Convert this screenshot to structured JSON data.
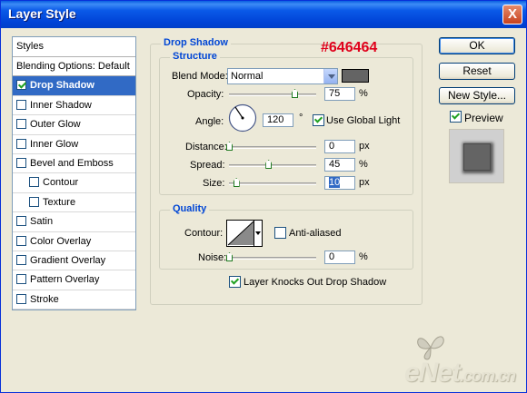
{
  "window": {
    "title": "Layer Style",
    "close_glyph": "X"
  },
  "styles_panel": {
    "header": "Styles",
    "blending_options": "Blending Options: Default",
    "items": [
      {
        "label": "Drop Shadow",
        "checked": true,
        "selected": true,
        "indent": false
      },
      {
        "label": "Inner Shadow",
        "checked": false,
        "selected": false,
        "indent": false
      },
      {
        "label": "Outer Glow",
        "checked": false,
        "selected": false,
        "indent": false
      },
      {
        "label": "Inner Glow",
        "checked": false,
        "selected": false,
        "indent": false
      },
      {
        "label": "Bevel and Emboss",
        "checked": false,
        "selected": false,
        "indent": false
      },
      {
        "label": "Contour",
        "checked": false,
        "selected": false,
        "indent": true
      },
      {
        "label": "Texture",
        "checked": false,
        "selected": false,
        "indent": true
      },
      {
        "label": "Satin",
        "checked": false,
        "selected": false,
        "indent": false
      },
      {
        "label": "Color Overlay",
        "checked": false,
        "selected": false,
        "indent": false
      },
      {
        "label": "Gradient Overlay",
        "checked": false,
        "selected": false,
        "indent": false
      },
      {
        "label": "Pattern Overlay",
        "checked": false,
        "selected": false,
        "indent": false
      },
      {
        "label": "Stroke",
        "checked": false,
        "selected": false,
        "indent": false
      }
    ]
  },
  "drop_shadow": {
    "section_title": "Drop Shadow",
    "color_annotation": "#646464",
    "structure": {
      "title": "Structure",
      "blend_mode": {
        "label": "Blend Mode:",
        "value": "Normal",
        "swatch_color": "#646464"
      },
      "opacity": {
        "label": "Opacity:",
        "value": "75",
        "unit": "%",
        "fraction": 0.75
      },
      "angle": {
        "label": "Angle:",
        "value": "120",
        "unit": "°",
        "use_global_light": {
          "label": "Use Global Light",
          "checked": true
        }
      },
      "distance": {
        "label": "Distance:",
        "value": "0",
        "unit": "px",
        "fraction": 0.0
      },
      "spread": {
        "label": "Spread:",
        "value": "45",
        "unit": "%",
        "fraction": 0.45
      },
      "size": {
        "label": "Size:",
        "value": "10",
        "unit": "px",
        "fraction": 0.08
      }
    },
    "quality": {
      "title": "Quality",
      "contour": {
        "label": "Contour:"
      },
      "anti_aliased": {
        "label": "Anti-aliased",
        "checked": false
      },
      "noise": {
        "label": "Noise:",
        "value": "0",
        "unit": "%",
        "fraction": 0.0
      }
    },
    "knocks_out": {
      "label": "Layer Knocks Out Drop Shadow",
      "checked": true
    }
  },
  "buttons": {
    "ok": "OK",
    "reset": "Reset",
    "new_style": "New Style..."
  },
  "preview": {
    "label": "Preview",
    "checked": true
  },
  "watermark": {
    "text": "eNet",
    "suffix": ".com.cn"
  }
}
